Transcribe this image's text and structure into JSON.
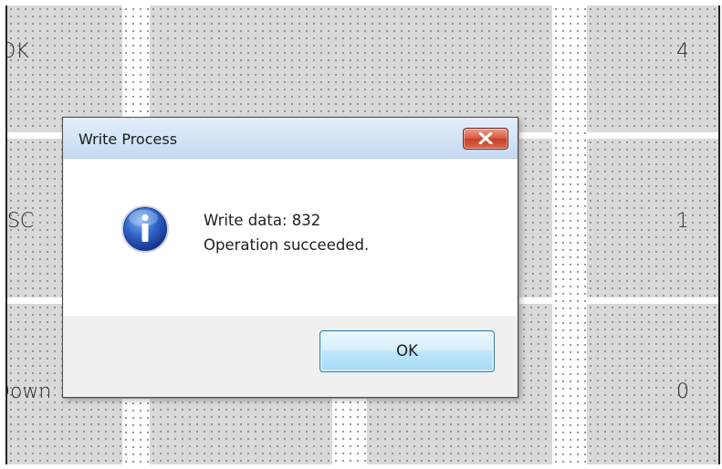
{
  "background_grid": {
    "row1": {
      "left_label": "OK",
      "right_value": "4"
    },
    "row2": {
      "left_label": "ESC",
      "right_value": "1"
    },
    "row3": {
      "left_label": "Down",
      "right_value": "0"
    }
  },
  "dialog": {
    "title": "Write Process",
    "icon": "information-icon",
    "message_line1": "Write data: 832",
    "message_line2": "Operation succeeded.",
    "ok_label": "OK"
  },
  "colors": {
    "titlebar": "#d3e3f6",
    "close_button": "#d8573c",
    "ok_button": "#bee6fd",
    "info_icon": "#2f63c7",
    "grid_cell": "#d9d9d9"
  }
}
